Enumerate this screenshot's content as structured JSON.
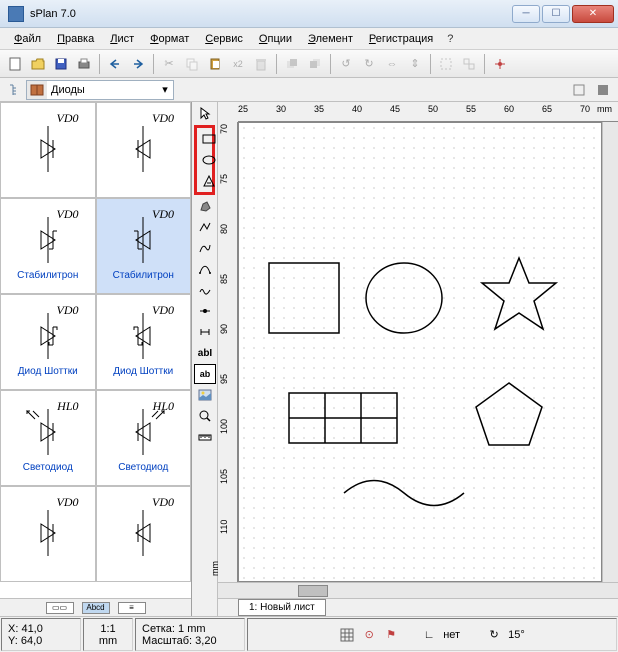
{
  "window": {
    "title": "sPlan 7.0"
  },
  "menu": {
    "items": [
      {
        "label": "Файл",
        "u": 0
      },
      {
        "label": "Правка",
        "u": 0
      },
      {
        "label": "Лист",
        "u": 0
      },
      {
        "label": "Формат",
        "u": 0
      },
      {
        "label": "Сервис",
        "u": 0
      },
      {
        "label": "Опции",
        "u": 0
      },
      {
        "label": "Элемент",
        "u": 0
      },
      {
        "label": "Регистрация",
        "u": 0
      }
    ],
    "help": "?"
  },
  "library": {
    "selector_label": "Диоды",
    "footer_mode": "Abcd",
    "items": [
      {
        "ref": "VD0",
        "label": "",
        "selected": false,
        "type": "diode"
      },
      {
        "ref": "VD0",
        "label": "",
        "selected": false,
        "type": "diode"
      },
      {
        "ref": "VD0",
        "label": "Стабилитрон",
        "selected": false,
        "type": "zener"
      },
      {
        "ref": "VD0",
        "label": "Стабилитрон",
        "selected": true,
        "type": "zener"
      },
      {
        "ref": "VD0",
        "label": "Диод Шоттки",
        "selected": false,
        "type": "schottky"
      },
      {
        "ref": "VD0",
        "label": "Диод Шоттки",
        "selected": false,
        "type": "schottky"
      },
      {
        "ref": "HL0",
        "label": "Светодиод",
        "selected": false,
        "type": "led"
      },
      {
        "ref": "HL0",
        "label": "Светодиод",
        "selected": false,
        "type": "led"
      },
      {
        "ref": "VD0",
        "label": "",
        "selected": false,
        "type": "diode"
      },
      {
        "ref": "VD0",
        "label": "",
        "selected": false,
        "type": "diode"
      }
    ]
  },
  "ruler": {
    "h_ticks": [
      "25",
      "30",
      "35",
      "40",
      "45",
      "50",
      "55",
      "60",
      "65",
      "70"
    ],
    "v_ticks": [
      "70",
      "75",
      "80",
      "85",
      "90",
      "95",
      "100",
      "105",
      "110"
    ],
    "unit": "mm"
  },
  "canvas_shapes": {
    "square": true,
    "circle": true,
    "star": true,
    "grid3x2": true,
    "pentagon": true,
    "wave": true
  },
  "tabs": {
    "active": "1: Новый лист"
  },
  "status": {
    "coords_x": "X: 41,0",
    "coords_y": "Y: 64,0",
    "zoom_ratio": "1:1",
    "zoom_unit": "mm",
    "grid_label": "Сетка: 1 mm",
    "scale_label": "Масштаб:  3,20",
    "snap_label": "нет",
    "angle_label": "15°"
  },
  "colors": {
    "accent": "#0040c0",
    "highlight": "#e02020",
    "selection": "#cfe0f8"
  }
}
